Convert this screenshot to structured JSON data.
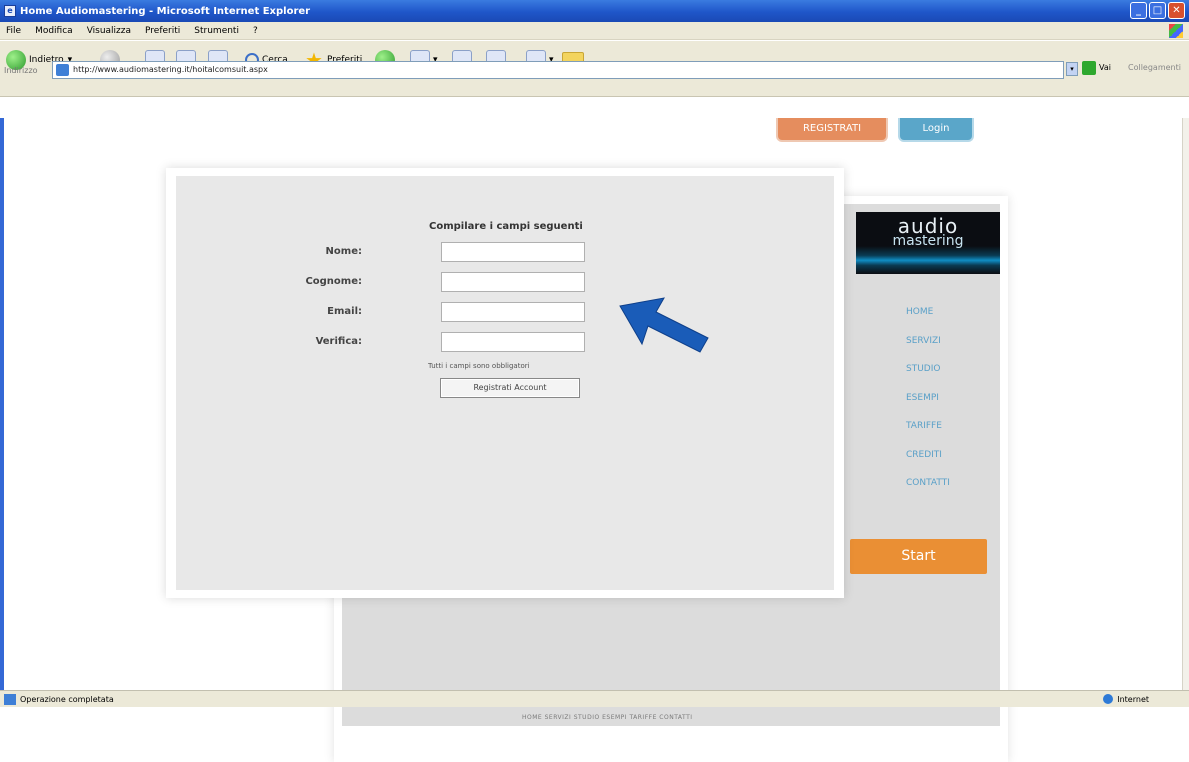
{
  "window": {
    "title": "Home Audiomastering - Microsoft Internet Explorer",
    "minimize": "_",
    "maximize": "□",
    "close": "✕"
  },
  "menu": [
    "File",
    "Modifica",
    "Visualizza",
    "Preferiti",
    "Strumenti",
    "?"
  ],
  "toolbar": {
    "back_label": "Indietro",
    "search_label": "Cerca",
    "favorites_label": "Preferiti"
  },
  "address": {
    "label": "Indirizzo",
    "url": "http://www.audiomastering.it/hoitalcomsuit.aspx",
    "go_label": "Vai",
    "links_label": "Collegamenti"
  },
  "page": {
    "register_button": "REGISTRATI",
    "login_button": "Login",
    "form": {
      "title": "Compilare i campi seguenti",
      "fields": [
        {
          "label": "Nome:",
          "value": ""
        },
        {
          "label": "Cognome:",
          "value": ""
        },
        {
          "label": "Email:",
          "value": ""
        },
        {
          "label": "Verifica:",
          "value": ""
        }
      ],
      "note": "Tutti i campi sono obbligatori",
      "submit": "Registrati Account"
    },
    "logo": {
      "line1": "audio",
      "line2": "mastering"
    },
    "nav": [
      "HOME",
      "SERVIZI",
      "STUDIO",
      "ESEMPI",
      "TARIFFE",
      "CREDITI",
      "CONTATTI"
    ],
    "start_button": "Start",
    "footer_links": "HOME  SERVIZI  STUDIO  ESEMPI  TARIFFE  CONTATTI"
  },
  "status": {
    "text": "Operazione completata",
    "zone": "Internet"
  },
  "colors": {
    "title_bar": "#1f56c9",
    "register": "#e58d5e",
    "login": "#5aa6c9",
    "start": "#ea8f34",
    "arrow": "#1a5cb8"
  }
}
